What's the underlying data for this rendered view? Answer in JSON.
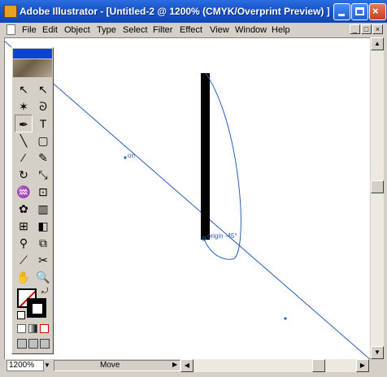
{
  "window": {
    "title": "Adobe Illustrator - [Untitled-2 @ 1200% (CMYK/Overprint Preview) ]",
    "buttons": {
      "minimize": "minimize",
      "maximize": "maximize",
      "close": "×"
    }
  },
  "menubar": {
    "items": [
      "File",
      "Edit",
      "Object",
      "Type",
      "Select",
      "Filter",
      "Effect",
      "View",
      "Window",
      "Help"
    ],
    "doc_buttons": [
      "_",
      "□",
      "×"
    ]
  },
  "canvas": {
    "guide_labels": {
      "on": "on",
      "origin": "origin -45°"
    },
    "colors": {
      "guide": "#2a5fb8",
      "shape": "#000000"
    }
  },
  "statusbar": {
    "zoom": "1200%",
    "tool_status": "Move"
  },
  "toolbox": {
    "tools": [
      {
        "name": "selection-tool",
        "glyph": "↖"
      },
      {
        "name": "direct-selection-tool",
        "glyph": "↖"
      },
      {
        "name": "magic-wand-tool",
        "glyph": "✶"
      },
      {
        "name": "lasso-tool",
        "glyph": "ᘐ"
      },
      {
        "name": "pen-tool",
        "glyph": "✒"
      },
      {
        "name": "type-tool",
        "glyph": "T"
      },
      {
        "name": "line-tool",
        "glyph": "╲"
      },
      {
        "name": "rectangle-tool",
        "glyph": "▢"
      },
      {
        "name": "paintbrush-tool",
        "glyph": "∕"
      },
      {
        "name": "pencil-tool",
        "glyph": "✎"
      },
      {
        "name": "rotate-tool",
        "glyph": "↻"
      },
      {
        "name": "scale-tool",
        "glyph": "⤡"
      },
      {
        "name": "warp-tool",
        "glyph": "♒"
      },
      {
        "name": "free-transform-tool",
        "glyph": "⊡"
      },
      {
        "name": "symbol-sprayer-tool",
        "glyph": "✿"
      },
      {
        "name": "graph-tool",
        "glyph": "▥"
      },
      {
        "name": "mesh-tool",
        "glyph": "⊞"
      },
      {
        "name": "gradient-tool",
        "glyph": "◧"
      },
      {
        "name": "eyedropper-tool",
        "glyph": "⚲"
      },
      {
        "name": "blend-tool",
        "glyph": "⧉"
      },
      {
        "name": "slice-tool",
        "glyph": "⟋"
      },
      {
        "name": "scissors-tool",
        "glyph": "✂"
      },
      {
        "name": "hand-tool",
        "glyph": "✋"
      },
      {
        "name": "zoom-tool",
        "glyph": "🔍"
      }
    ]
  }
}
